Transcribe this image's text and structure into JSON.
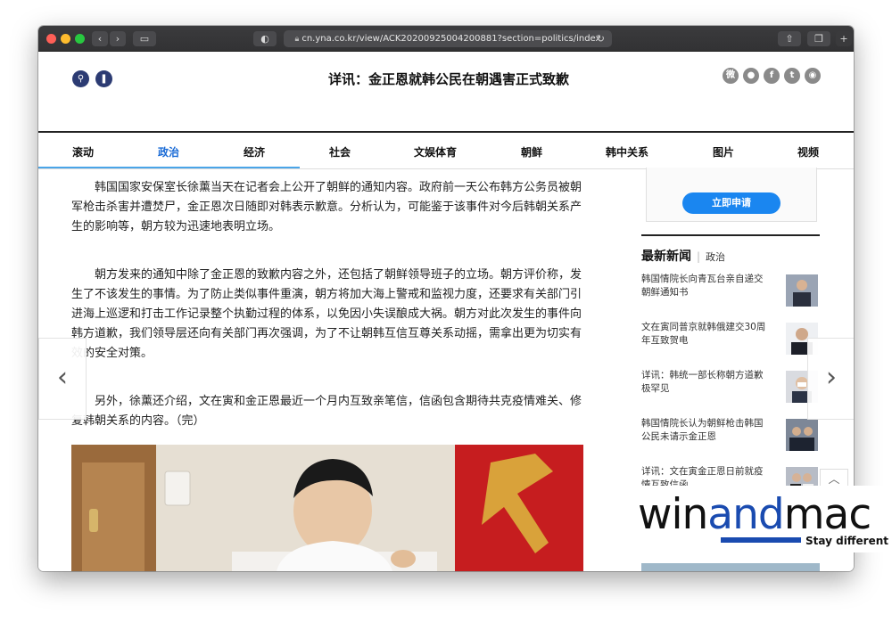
{
  "browser": {
    "url": "cn.yna.co.kr/view/ACK20200925004200881?section=politics/index"
  },
  "header": {
    "title": "详讯：金正恩就韩公民在朝遇害正式致歉"
  },
  "nav": {
    "items": [
      {
        "label": "滚动"
      },
      {
        "label": "政治"
      },
      {
        "label": "经济"
      },
      {
        "label": "社会"
      },
      {
        "label": "文娱体育"
      },
      {
        "label": "朝鲜"
      },
      {
        "label": "韩中关系"
      },
      {
        "label": "图片"
      },
      {
        "label": "视频"
      }
    ],
    "active": "政治"
  },
  "article": {
    "paragraphs": [
      "韩国国家安保室长徐薰当天在记者会上公开了朝鲜的通知内容。政府前一天公布韩方公务员被朝军枪击杀害并遭焚尸，金正恩次日随即对韩表示歉意。分析认为，可能鉴于该事件对今后韩朝关系产生的影响等，朝方较为迅速地表明立场。",
      "朝方发来的通知中除了金正恩的致歉内容之外，还包括了朝鲜领导班子的立场。朝方评价称，发生了不该发生的事情。为了防止类似事件重演，朝方将加大海上警戒和监视力度，还要求有关部门引进海上巡逻和打击工作记录整个执勤过程的体系，以免因小失误酿成大祸。朝方对此次发生的事件向韩方道歉，我们领导层还向有关部门再次强调，为了不让朝韩互信互尊关系动摇，需拿出更为切实有效的安全对策。",
      "另外，徐薰还介绍，文在寅和金正恩最近一个月内互致亲笔信，信函包含期待共克疫情难关、修复韩朝关系的内容。（完）"
    ]
  },
  "sidebar": {
    "apply_button": "立即申请",
    "latest_title": "最新新闻",
    "latest_section": "政治",
    "news": [
      {
        "text": "韩国情院长向青瓦台亲自递交朝鲜通知书"
      },
      {
        "text": "文在寅同普京就韩俄建交30周年互致贺电"
      },
      {
        "text": "详讯：韩统一部长称朝方道歉极罕见"
      },
      {
        "text": "韩国情院长认为朝鲜枪击韩国公民未请示金正恩"
      },
      {
        "text": "详讯：文在寅金正恩日前就疫情互致信函"
      }
    ]
  },
  "watermark": {
    "brand_a": "win",
    "brand_b": "and",
    "brand_c": "mac",
    "tagline": "Stay different"
  }
}
